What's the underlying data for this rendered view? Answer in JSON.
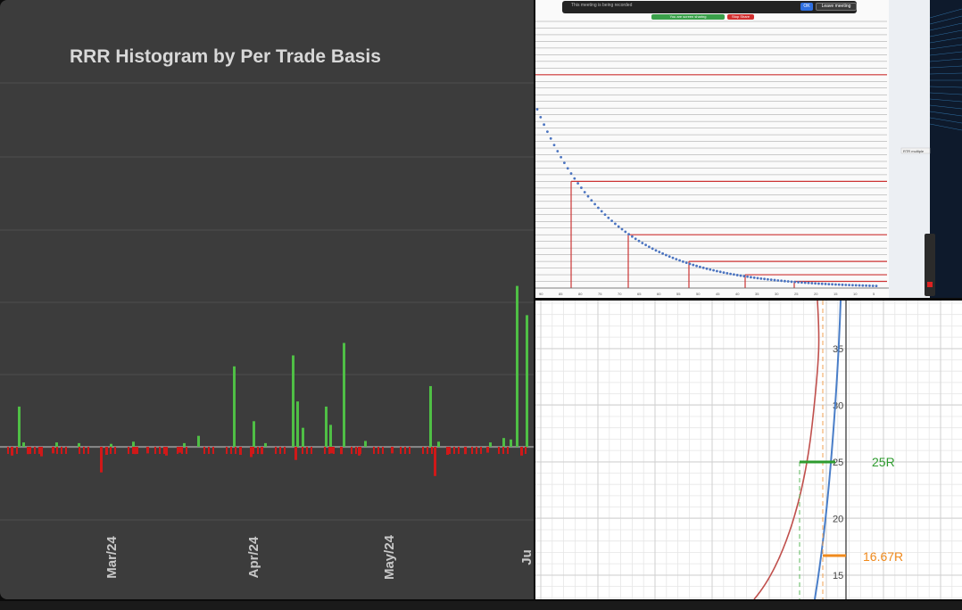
{
  "histogram": {
    "title": "RRR Histogram by Per Trade Basis",
    "colors": {
      "positive": "#4fbf45",
      "negative": "#d01818",
      "background": "#3c3c3c",
      "grid": "#4e4e4e"
    },
    "month_labels": [
      "Mar/24",
      "Apr/24",
      "May/24",
      "Ju"
    ],
    "chart_data": {
      "type": "bar",
      "x_labels": [
        "Mar/24",
        "Apr/24",
        "May/24"
      ],
      "positive_values": [
        5.5,
        0.6,
        0.6,
        0.5,
        0.4,
        0.7,
        0.5,
        1.5,
        11.0,
        3.5,
        0.5,
        12.5,
        6.2,
        2.6,
        5.5,
        3.0,
        14.2,
        0.8,
        8.3,
        0.7,
        0.6,
        1.2,
        1.0,
        22.0,
        18.0
      ],
      "negative_values": [
        -1.2,
        -1.0,
        -1.3,
        -0.9,
        -3.5,
        -1.1,
        -1.0,
        -0.9,
        -1.2,
        -0.8,
        -1.1,
        -1.4,
        -1.0,
        -1.8,
        -0.9,
        -1.0,
        -1.2,
        -0.9,
        -4.0,
        -1.1,
        -1.0,
        -0.8,
        -1.2
      ]
    }
  },
  "meeting": {
    "status_text": "This meeting is being recorded",
    "leave_label": "Leave meeting",
    "ok_label": "OK",
    "green_banner": "You are screen sharing",
    "red_banner": "Stop Share",
    "legend": "RTR multiple",
    "chart_data": {
      "type": "scatter",
      "series": [
        {
          "name": "RTR multiple",
          "shape": "decaying curve"
        }
      ],
      "y_ticks": [
        "10.00",
        "9.75",
        "9.50",
        "9.25",
        "9.00",
        "8.75",
        "8.50",
        "8.25",
        "8.00",
        "7.75",
        "7.50",
        "7.25",
        "7.00",
        "6.75",
        "6.50",
        "6.25",
        "6.00",
        "5.75",
        "5.50",
        "5.25",
        "5.00",
        "4.75",
        "4.50",
        "4.25",
        "4.00",
        "3.75",
        "3.50",
        "3.25",
        "3.00",
        "2.75",
        "2.50",
        "2.25",
        "2.00",
        "1.75",
        "1.50",
        "1.25",
        "1.00",
        "0.75",
        "0.50",
        "0.25",
        "0.00"
      ],
      "x_ticks": [
        "90",
        "85",
        "80",
        "75",
        "70",
        "65",
        "60",
        "55",
        "50",
        "45",
        "40",
        "35",
        "30",
        "25",
        "20",
        "15",
        "10",
        "5"
      ],
      "horizontal_red_levels": [
        8.0,
        4.0,
        2.0,
        1.0,
        0.5,
        0.25
      ]
    }
  },
  "curve_plot": {
    "y_ticks": [
      "35",
      "30",
      "25",
      "20",
      "15"
    ],
    "labels": {
      "green": "25R",
      "orange": "16.67R"
    },
    "colors": {
      "green": "#2e9b2e",
      "orange": "#f08a1c",
      "red_curve": "#c0504d",
      "blue_curve": "#4a7ec8"
    }
  }
}
